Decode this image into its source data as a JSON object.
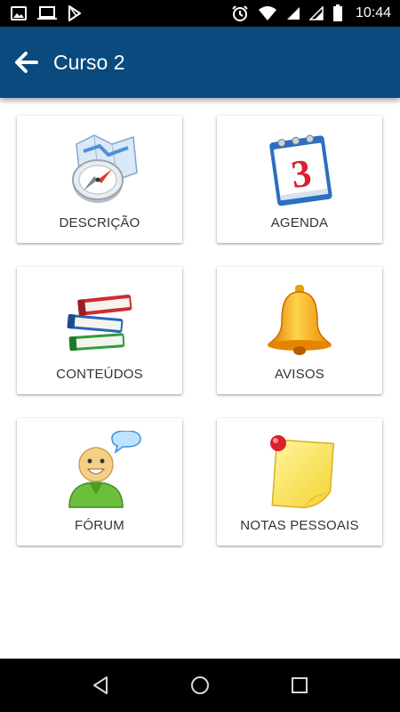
{
  "status_bar": {
    "time": "10:44",
    "icons": [
      "image-icon",
      "laptop-icon",
      "play-store-icon",
      "alarm-icon",
      "wifi-icon",
      "signal-icon",
      "signal-icon",
      "battery-icon"
    ]
  },
  "app_bar": {
    "title": "Curso 2",
    "back_icon": "arrow-left-icon",
    "background_color": "#0b4a7e"
  },
  "menu": {
    "items": [
      {
        "label": "DESCRIÇÃO",
        "icon": "compass-map-icon"
      },
      {
        "label": "AGENDA",
        "icon": "calendar-icon"
      },
      {
        "label": "CONTEÚDOS",
        "icon": "books-icon"
      },
      {
        "label": "AVISOS",
        "icon": "bell-icon"
      },
      {
        "label": "FÓRUM",
        "icon": "chat-user-icon"
      },
      {
        "label": "NOTAS PESSOAIS",
        "icon": "sticky-note-icon"
      }
    ],
    "calendar_number": "3"
  },
  "nav_bar": {
    "icons": [
      "back-triangle-icon",
      "home-circle-icon",
      "recents-square-icon"
    ]
  }
}
